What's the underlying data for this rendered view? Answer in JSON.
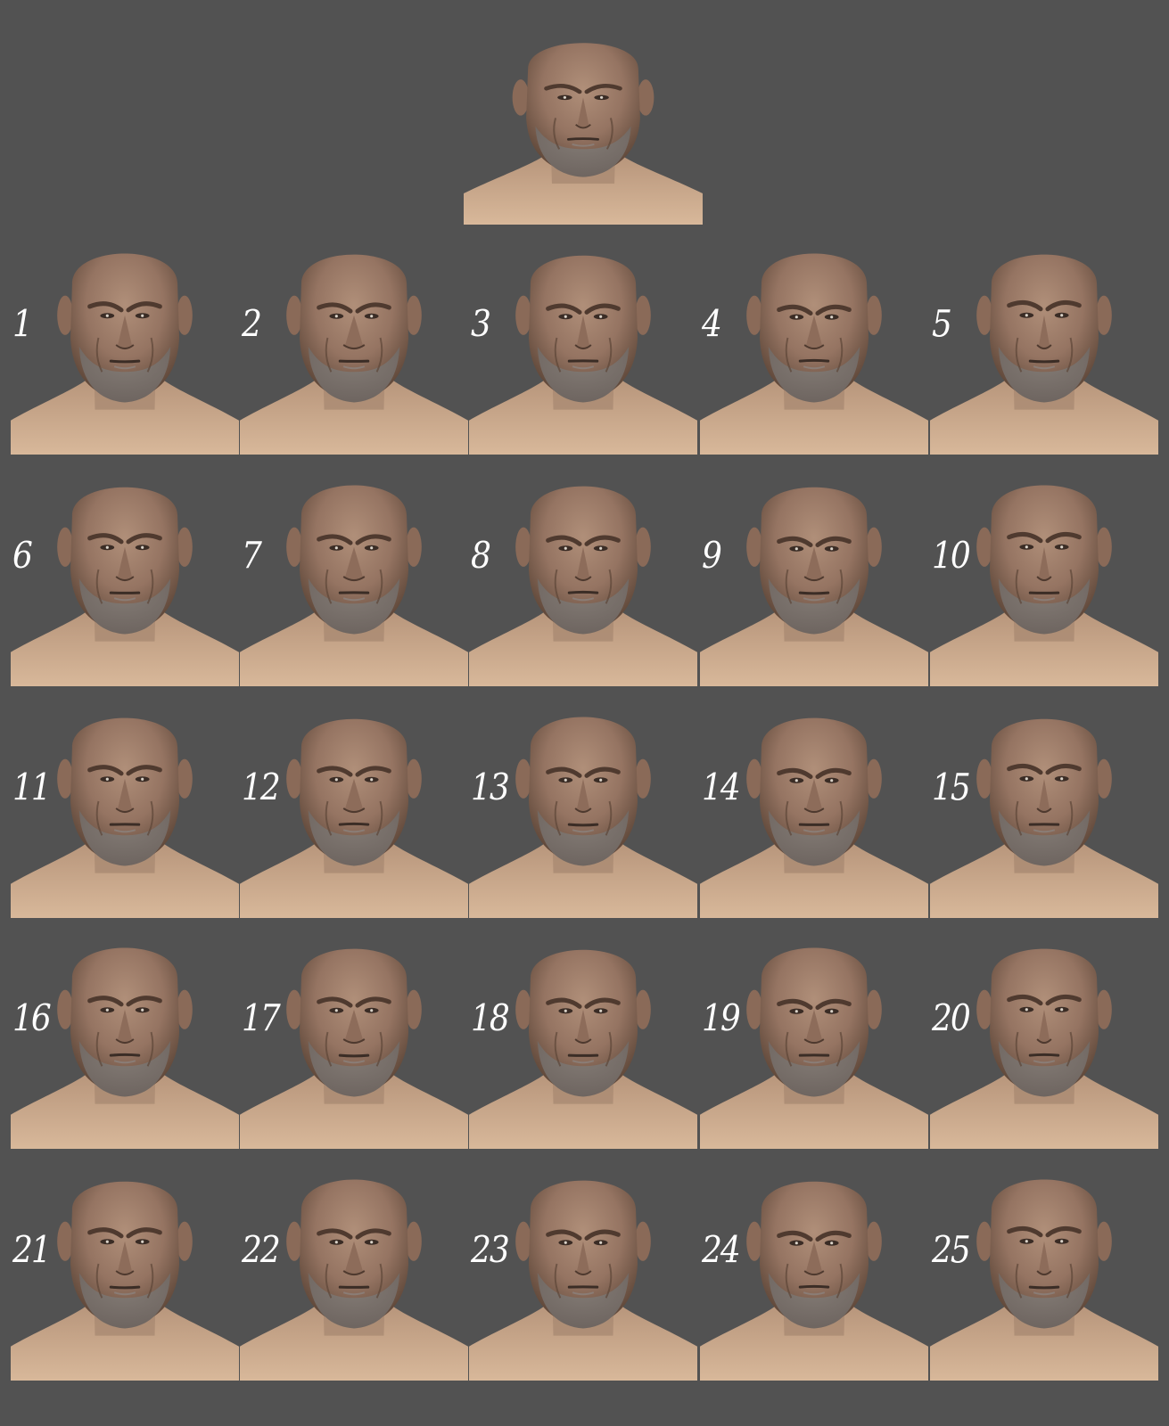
{
  "colors": {
    "background": "#525252",
    "skin_light": "#c9a687",
    "skin_mid": "#a9876c",
    "skin_dark": "#6b5345",
    "beard": "#6e6560",
    "label": "#ffffff"
  },
  "reference": {
    "icon": "character-head-bust"
  },
  "variants": [
    {
      "label": "1"
    },
    {
      "label": "2"
    },
    {
      "label": "3"
    },
    {
      "label": "4"
    },
    {
      "label": "5"
    },
    {
      "label": "6"
    },
    {
      "label": "7"
    },
    {
      "label": "8"
    },
    {
      "label": "9"
    },
    {
      "label": "10"
    },
    {
      "label": "11"
    },
    {
      "label": "12"
    },
    {
      "label": "13"
    },
    {
      "label": "14"
    },
    {
      "label": "15"
    },
    {
      "label": "16"
    },
    {
      "label": "17"
    },
    {
      "label": "18"
    },
    {
      "label": "19"
    },
    {
      "label": "20"
    },
    {
      "label": "21"
    },
    {
      "label": "22"
    },
    {
      "label": "23"
    },
    {
      "label": "24"
    },
    {
      "label": "25"
    }
  ]
}
